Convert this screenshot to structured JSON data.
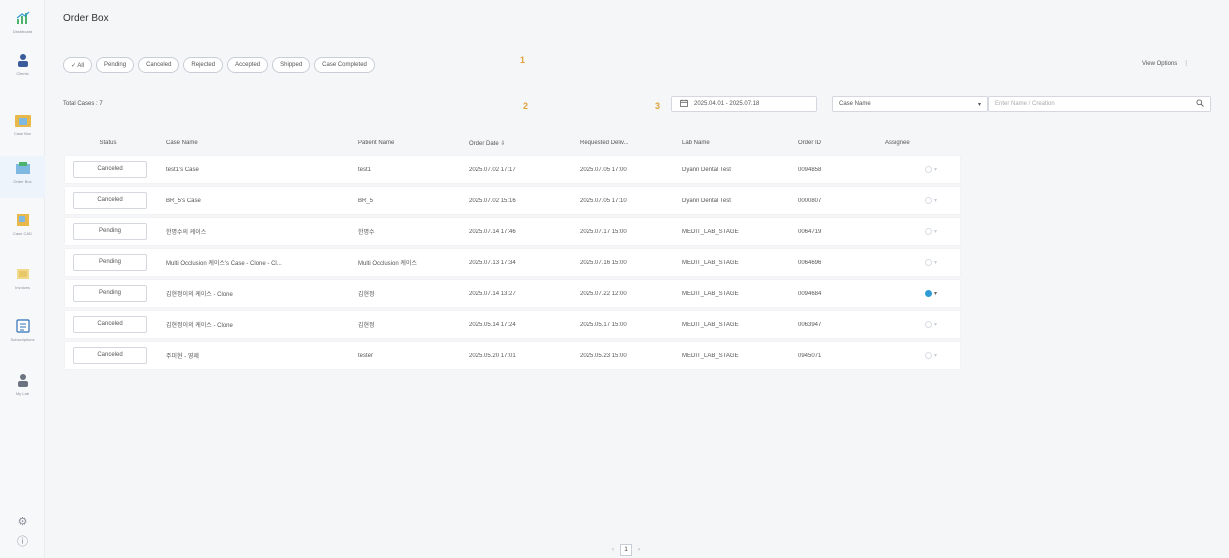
{
  "sidebar": {
    "items": [
      {
        "label": "Dashboard",
        "icon": "chart-icon"
      },
      {
        "label": "Clients",
        "icon": "user-icon"
      },
      {
        "label": "Case Box",
        "icon": "folder-icon"
      },
      {
        "label": "Order Box",
        "icon": "box-icon"
      },
      {
        "label": "Case CAD",
        "icon": "document-icon"
      },
      {
        "label": "Invoices",
        "icon": "invoice-icon"
      },
      {
        "label": "Subscriptions",
        "icon": "list-icon"
      },
      {
        "label": "My Lab",
        "icon": "profile-icon"
      }
    ],
    "bottom": [
      {
        "icon": "settings-icon",
        "glyph": "⚙"
      },
      {
        "icon": "info-icon",
        "glyph": "ⓘ"
      }
    ]
  },
  "header": {
    "title": "Order Box"
  },
  "filters": {
    "chips": [
      "✓ All",
      "Pending",
      "Canceled",
      "Rejected",
      "Accepted",
      "Shipped",
      "Case Completed"
    ],
    "marker": "1"
  },
  "view_options": {
    "label": "View Options",
    "icon": "more-vertical-icon",
    "glyph": "⋮"
  },
  "toolbar": {
    "total": "Total Cases : 7",
    "marker2": "2",
    "marker3": "3",
    "date_range": "2025.04.01 - 2025.07.18",
    "date_icon": "📅",
    "case_select": "Case Name",
    "select_icon": "▾",
    "search_placeholder": "Enter Name / Creation",
    "search_icon": "🔍"
  },
  "table": {
    "columns": [
      "Status",
      "Case Name",
      "Patient Name",
      "Order Date ⇩",
      "Requested Deliv...",
      "Lab Name",
      "Order ID",
      "Assignee"
    ],
    "rows": [
      {
        "status": "Canceled",
        "case": "test1's Case",
        "patient": "test1",
        "odate": "2025.07.02 17:17",
        "rdate": "2025.07.05 17:00",
        "lab": "Dyann Dental Test",
        "oid": "0094858",
        "assigned": false
      },
      {
        "status": "Canceled",
        "case": "BR_5's Case",
        "patient": "BR_5",
        "odate": "2025.07.02 15:16",
        "rdate": "2025.07.05 17:10",
        "lab": "Dyann Dental Test",
        "oid": "0000807",
        "assigned": false
      },
      {
        "status": "Pending",
        "case": "한명수의 케이스",
        "patient": "한명수",
        "odate": "2025.07.14 17:46",
        "rdate": "2025.07.17 15:00",
        "lab": "MEDIT_LAB_STAGE",
        "oid": "0064719",
        "assigned": false
      },
      {
        "status": "Pending",
        "case": "Multi Occlusion 케이스's Case - Clone - Cl...",
        "patient": "Multi Occlusion 케이스",
        "odate": "2025.07.13 17:34",
        "rdate": "2025.07.16 15:00",
        "lab": "MEDIT_LAB_STAGE",
        "oid": "0064696",
        "assigned": false
      },
      {
        "status": "Pending",
        "case": "김현정이의 케이스 - Clone",
        "patient": "김현정",
        "odate": "2025.07.14 13:27",
        "rdate": "2025.07.22 12:00",
        "lab": "MEDIT_LAB_STAGE",
        "oid": "0094684",
        "assigned": true
      },
      {
        "status": "Canceled",
        "case": "김현정이의 케이스 - Clone",
        "patient": "김현정",
        "odate": "2025.05.14 17:24",
        "rdate": "2025.05.17 15:00",
        "lab": "MEDIT_LAB_STAGE",
        "oid": "0063947",
        "assigned": false
      },
      {
        "status": "Canceled",
        "case": "주미현 - 영제",
        "patient": "tester",
        "odate": "2025.05.20 17:01",
        "rdate": "2025.05.23 15:00",
        "lab": "MEDIT_LAB_STAGE",
        "oid": "0945071",
        "assigned": false
      }
    ]
  },
  "pager": {
    "prev": "‹",
    "current": "1",
    "next": "›"
  },
  "colors": {
    "accent": "#2f9bd6",
    "marker": "#e0a23a"
  }
}
